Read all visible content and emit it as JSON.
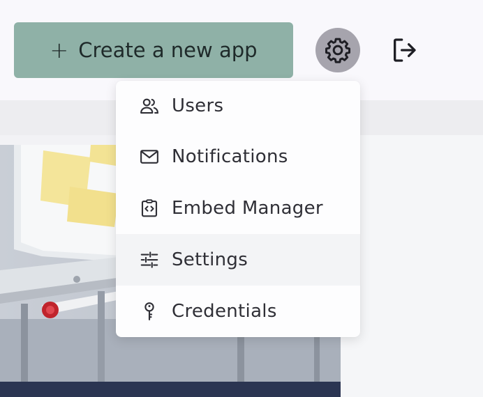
{
  "header": {
    "create_button_label": "Create a new app",
    "create_button_icon": "plus-icon",
    "settings_icon": "gear-icon",
    "logout_icon": "logout-icon"
  },
  "menu": {
    "items": [
      {
        "label": "Users",
        "icon": "users-icon"
      },
      {
        "label": "Notifications",
        "icon": "envelope-icon"
      },
      {
        "label": "Embed Manager",
        "icon": "embed-code-icon"
      },
      {
        "label": "Settings",
        "icon": "sliders-icon",
        "highlighted": true
      },
      {
        "label": "Credentials",
        "icon": "key-icon"
      }
    ]
  },
  "colors": {
    "accent_button": "#8fb1a7",
    "gear_circle": "#a6a4ad",
    "photo_bar": "#2b3552"
  }
}
